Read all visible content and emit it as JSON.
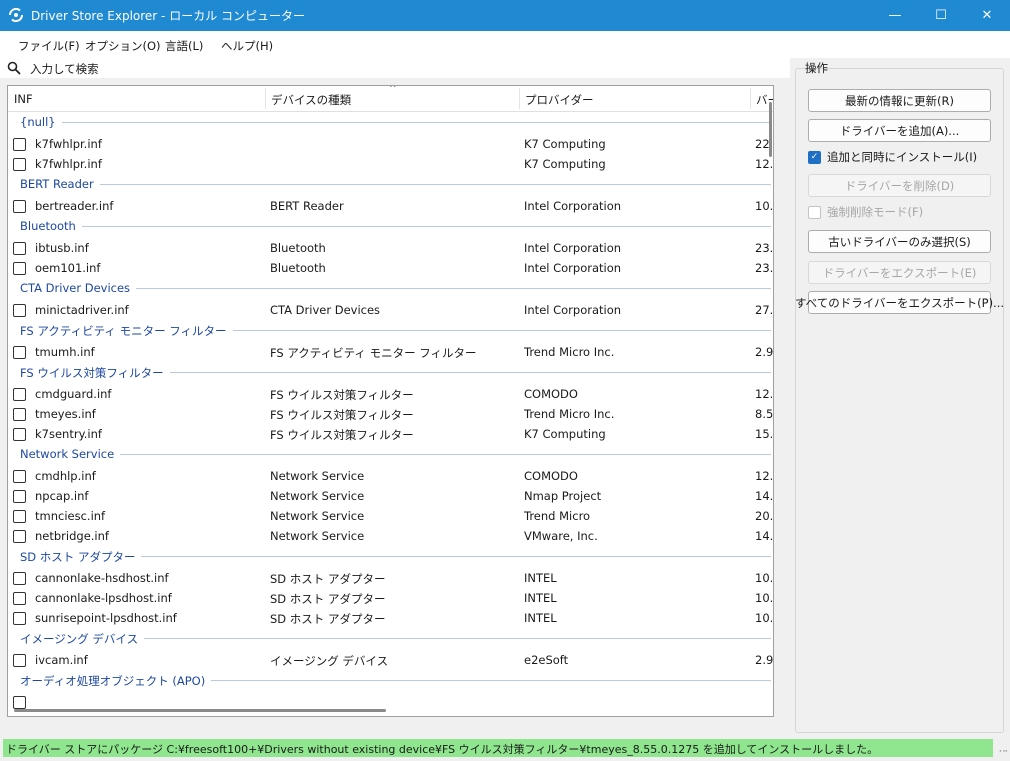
{
  "window": {
    "title": "Driver Store Explorer - ローカル コンピューター",
    "minimize_glyph": "—",
    "maximize_glyph": "☐",
    "close_glyph": "✕"
  },
  "menu": {
    "file": "ファイル(F)",
    "options": "オプション(O)",
    "language": "言語(L)",
    "help": "ヘルプ(H)"
  },
  "search": {
    "placeholder": "入力して検索",
    "icon": "search-icon"
  },
  "table": {
    "columns": [
      "INF",
      "デバイスの種類",
      "プロバイダー",
      "バー"
    ],
    "groups": [
      {
        "name": "{null}",
        "rows": [
          {
            "inf": "k7fwhlpr.inf",
            "type": "",
            "provider": "K7 Computing",
            "ver": "22."
          },
          {
            "inf": "k7fwhlpr.inf",
            "type": "",
            "provider": "K7 Computing",
            "ver": "12."
          }
        ]
      },
      {
        "name": "BERT Reader",
        "rows": [
          {
            "inf": "bertreader.inf",
            "type": "BERT Reader",
            "provider": "Intel Corporation",
            "ver": "10."
          }
        ]
      },
      {
        "name": "Bluetooth",
        "rows": [
          {
            "inf": "ibtusb.inf",
            "type": "Bluetooth",
            "provider": "Intel Corporation",
            "ver": "23."
          },
          {
            "inf": "oem101.inf",
            "type": "Bluetooth",
            "provider": "Intel Corporation",
            "ver": "23."
          }
        ]
      },
      {
        "name": "CTA Driver Devices",
        "rows": [
          {
            "inf": "minictadriver.inf",
            "type": "CTA Driver Devices",
            "provider": "Intel Corporation",
            "ver": "27."
          }
        ]
      },
      {
        "name": "FS アクティビティ モニター フィルター",
        "rows": [
          {
            "inf": "tmumh.inf",
            "type": "FS アクティビティ モニター フィルター",
            "provider": "Trend Micro Inc.",
            "ver": "2.9"
          }
        ]
      },
      {
        "name": "FS ウイルス対策フィルター",
        "rows": [
          {
            "inf": "cmdguard.inf",
            "type": "FS ウイルス対策フィルター",
            "provider": "COMODO",
            "ver": "12."
          },
          {
            "inf": "tmeyes.inf",
            "type": "FS ウイルス対策フィルター",
            "provider": "Trend Micro Inc.",
            "ver": "8.5"
          },
          {
            "inf": "k7sentry.inf",
            "type": "FS ウイルス対策フィルター",
            "provider": "K7 Computing",
            "ver": "15."
          }
        ]
      },
      {
        "name": "Network Service",
        "rows": [
          {
            "inf": "cmdhlp.inf",
            "type": "Network Service",
            "provider": "COMODO",
            "ver": "12."
          },
          {
            "inf": "npcap.inf",
            "type": "Network Service",
            "provider": "Nmap Project",
            "ver": "14."
          },
          {
            "inf": "tmnciesc.inf",
            "type": "Network Service",
            "provider": "Trend Micro",
            "ver": "20."
          },
          {
            "inf": "netbridge.inf",
            "type": "Network Service",
            "provider": "VMware, Inc.",
            "ver": "14."
          }
        ]
      },
      {
        "name": "SD ホスト アダプター",
        "rows": [
          {
            "inf": "cannonlake-hsdhost.inf",
            "type": "SD ホスト アダプター",
            "provider": "INTEL",
            "ver": "10."
          },
          {
            "inf": "cannonlake-lpsdhost.inf",
            "type": "SD ホスト アダプター",
            "provider": "INTEL",
            "ver": "10."
          },
          {
            "inf": "sunrisepoint-lpsdhost.inf",
            "type": "SD ホスト アダプター",
            "provider": "INTEL",
            "ver": "10."
          }
        ]
      },
      {
        "name": "イメージング デバイス",
        "rows": [
          {
            "inf": "ivcam.inf",
            "type": "イメージング デバイス",
            "provider": "e2eSoft",
            "ver": "2.9"
          }
        ]
      },
      {
        "name": "オーディオ処理オブジェクト (APO)",
        "rows": []
      }
    ]
  },
  "actions": {
    "legend": "操作",
    "refresh": "最新の情報に更新(R)",
    "add_driver": "ドライバーを追加(A)...",
    "install_on_add": "追加と同時にインストール(I)",
    "delete_driver": "ドライバーを削除(D)",
    "force_delete": "強制削除モード(F)",
    "select_old": "古いドライバーのみ選択(S)",
    "export_driver": "ドライバーをエクスポート(E)",
    "export_all": "すべてのドライバーをエクスポート(P)..."
  },
  "status": {
    "message": "ドライバー ストアにパッケージ C:¥freesoft100+¥Drivers without existing device¥FS ウイルス対策フィルター¥tmeyes_8.55.0.1275 を追加してインストールしました。",
    "color": "#8fe68f"
  },
  "colors": {
    "titlebar": "#1f8ad2",
    "group_header": "#1e48a0",
    "checkbox_checked": "#1f6fc5"
  }
}
